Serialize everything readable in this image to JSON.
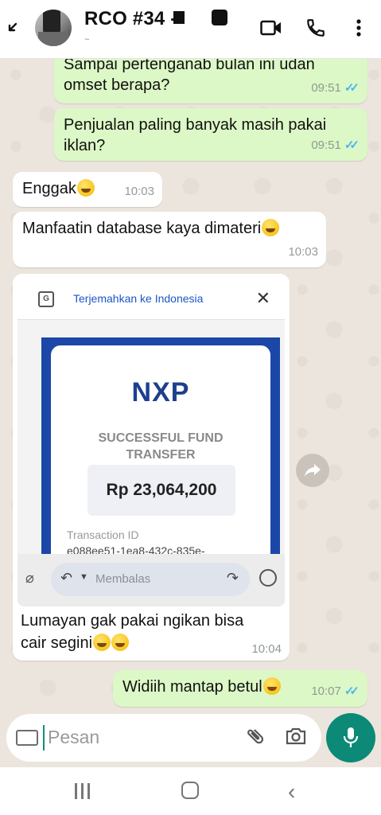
{
  "header": {
    "title": "RCO #34 -",
    "status": "~",
    "back_icon": "back-arrow-icon",
    "actions": [
      "video-call-icon",
      "phone-icon",
      "more-vert-icon"
    ]
  },
  "messages": [
    {
      "id": "m1",
      "dir": "out",
      "text_line1": "Sampai pertenganab bulan ini udan",
      "text_line2": "omset berapa?",
      "time": "09:51",
      "ticks": "✓✓"
    },
    {
      "id": "m2",
      "dir": "out",
      "text_line1": "Penjualan paling banyak masih pakai",
      "text_line2": "iklan?",
      "time": "09:51",
      "ticks": "✓✓"
    },
    {
      "id": "m3",
      "dir": "in",
      "text": "Enggak",
      "time": "10:03"
    },
    {
      "id": "m4",
      "dir": "in",
      "text": "Manfaatin database kaya dimateri",
      "time": "10:03"
    },
    {
      "id": "m5",
      "dir": "in",
      "caption_line1": "Lumayan gak pakai ngikan bisa",
      "caption_line2": "cair segini",
      "time": "10:04"
    },
    {
      "id": "m6",
      "dir": "out",
      "text": "Widiih mantap betul",
      "time": "10:07",
      "ticks": "✓✓"
    }
  ],
  "screenshot": {
    "translate_label": "Terjemahkan ke Indonesia",
    "translate_close": "✕",
    "brand": "NXP",
    "subtitle_line1": "SUCCESSFUL FUND",
    "subtitle_line2": "TRANSFER",
    "amount": "Rp 23,064,200",
    "tx_label": "Transaction ID",
    "tx_value": "e088ee51-1ea8-432c-835e-",
    "reply_placeholder": "Membalas"
  },
  "composer": {
    "placeholder": "Pesan"
  },
  "colors": {
    "outgoing": "#dcf8c6",
    "incoming": "#ffffff",
    "accent": "#0c8a77",
    "read_ticks": "#4fb6ec",
    "nxp_blue": "#1b47a8"
  }
}
